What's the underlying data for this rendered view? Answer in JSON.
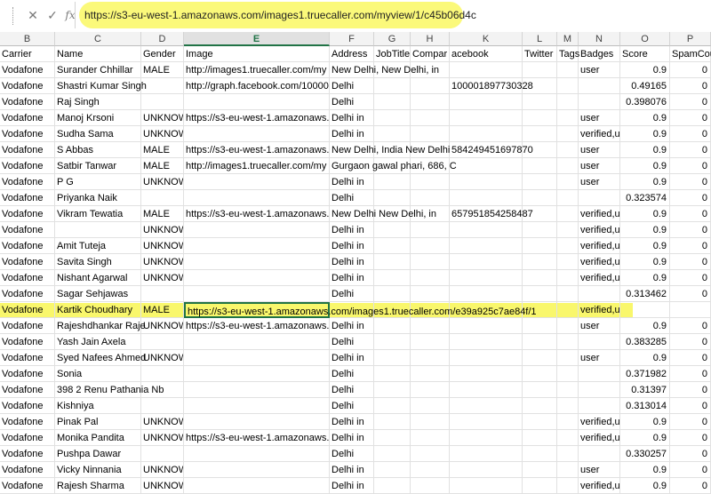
{
  "formula_bar": {
    "cancel_icon": "cross-icon",
    "enter_icon": "check-icon",
    "function_label": "fx",
    "content": "https://s3-eu-west-1.amazonaws.com/images1.truecaller.com/myview/1/c45b06d4c"
  },
  "columns": [
    "B",
    "C",
    "D",
    "E",
    "F",
    "G",
    "H",
    "K",
    "L",
    "M",
    "N",
    "O",
    "P"
  ],
  "active_column": "E",
  "highlight_color": "#fbf97a",
  "header_row": [
    "Carrier",
    "Name",
    "Gender",
    "Image",
    "Address",
    "JobTitle",
    "Compar",
    "acebook",
    "Twitter",
    "Tags",
    "Badges",
    "Score",
    "SpamCount"
  ],
  "rows": [
    [
      "Vodafone",
      "Surander Chhillar",
      "MALE",
      "http://images1.truecaller.com/my",
      "New Delhi, New Delhi, in",
      "",
      "",
      "",
      "",
      "",
      "user",
      "0.9",
      "0"
    ],
    [
      "Vodafone",
      "Shastri Kumar Singh",
      "",
      "http://graph.facebook.com/10000",
      "Delhi",
      "",
      "",
      "100001897730328",
      "",
      "",
      "",
      "0.49165",
      "0"
    ],
    [
      "Vodafone",
      "Raj Singh",
      "",
      "",
      "Delhi",
      "",
      "",
      "",
      "",
      "",
      "",
      "0.398076",
      "0"
    ],
    [
      "Vodafone",
      "Manoj Krsoni",
      "UNKNOWN",
      "https://s3-eu-west-1.amazonaws.",
      "Delhi in",
      "",
      "",
      "",
      "",
      "",
      "user",
      "0.9",
      "0"
    ],
    [
      "Vodafone",
      "Sudha Sama",
      "UNKNOWN",
      "",
      "Delhi in",
      "",
      "",
      "",
      "",
      "",
      "verified,u",
      "0.9",
      "0"
    ],
    [
      "Vodafone",
      "S Abbas",
      "MALE",
      "https://s3-eu-west-1.amazonaws.",
      "New Delhi, India New Delhi",
      "",
      "",
      "584249451697870",
      "",
      "",
      "user",
      "0.9",
      "0"
    ],
    [
      "Vodafone",
      "Satbir Tanwar",
      "MALE",
      "http://images1.truecaller.com/my",
      "Gurgaon gawal phari, 686, C",
      "",
      "",
      "",
      "",
      "",
      "user",
      "0.9",
      "0"
    ],
    [
      "Vodafone",
      "P G",
      "UNKNOWN",
      "",
      "Delhi in",
      "",
      "",
      "",
      "",
      "",
      "user",
      "0.9",
      "0"
    ],
    [
      "Vodafone",
      "Priyanka Naik",
      "",
      "",
      "Delhi",
      "",
      "",
      "",
      "",
      "",
      "",
      "0.323574",
      "0"
    ],
    [
      "Vodafone",
      "Vikram Tewatia",
      "MALE",
      "https://s3-eu-west-1.amazonaws.",
      "New Delhi New Delhi, in",
      "",
      "",
      "657951854258487",
      "",
      "",
      "verified,u",
      "0.9",
      "0"
    ],
    [
      "Vodafone",
      "",
      "UNKNOWN",
      "",
      "Delhi in",
      "",
      "",
      "",
      "",
      "",
      "verified,u",
      "0.9",
      "0"
    ],
    [
      "Vodafone",
      "Amit Tuteja",
      "UNKNOWN",
      "",
      "Delhi in",
      "",
      "",
      "",
      "",
      "",
      "verified,u",
      "0.9",
      "0"
    ],
    [
      "Vodafone",
      "Savita Singh",
      "UNKNOWN",
      "",
      "Delhi in",
      "",
      "",
      "",
      "",
      "",
      "verified,u",
      "0.9",
      "0"
    ],
    [
      "Vodafone",
      "Nishant Agarwal",
      "UNKNOWN",
      "",
      "Delhi in",
      "",
      "",
      "",
      "",
      "",
      "verified,u",
      "0.9",
      "0"
    ],
    [
      "Vodafone",
      "Sagar Sehjawas",
      "",
      "",
      "Delhi",
      "",
      "",
      "",
      "",
      "",
      "",
      "0.313462",
      "0"
    ],
    [
      "Vodafone",
      "Kartik Choudhary",
      "MALE",
      "https://s3-eu-west-1.amazonaws.com/images1.truecaller.com/e39a925c7ae84f/1",
      "",
      "",
      "",
      "",
      "",
      "",
      "verified,u",
      "",
      ""
    ],
    [
      "Vodafone",
      "Rajeshdhankar Raje",
      "UNKNOW",
      "https://s3-eu-west-1.amazonaws.",
      "Delhi in",
      "",
      "",
      "",
      "",
      "",
      "user",
      "0.9",
      "0"
    ],
    [
      "Vodafone",
      "Yash Jain Axela",
      "",
      "",
      "Delhi",
      "",
      "",
      "",
      "",
      "",
      "",
      "0.383285",
      "0"
    ],
    [
      "Vodafone",
      "Syed Nafees Ahmed",
      "UNKNOWN",
      "",
      "Delhi in",
      "",
      "",
      "",
      "",
      "",
      "user",
      "0.9",
      "0"
    ],
    [
      "Vodafone",
      "Sonia",
      "",
      "",
      "Delhi",
      "",
      "",
      "",
      "",
      "",
      "",
      "0.371982",
      "0"
    ],
    [
      "Vodafone",
      "398 2 Renu Pathania Nb",
      "",
      "",
      "Delhi",
      "",
      "",
      "",
      "",
      "",
      "",
      "0.31397",
      "0"
    ],
    [
      "Vodafone",
      "Kishniya",
      "",
      "",
      "Delhi",
      "",
      "",
      "",
      "",
      "",
      "",
      "0.313014",
      "0"
    ],
    [
      "Vodafone",
      "Pinak Pal",
      "UNKNOWN",
      "",
      "Delhi in",
      "",
      "",
      "",
      "",
      "",
      "verified,u",
      "0.9",
      "0"
    ],
    [
      "Vodafone",
      "Monika Pandita",
      "UNKNOWN",
      "https://s3-eu-west-1.amazonaws.",
      "Delhi in",
      "",
      "",
      "",
      "",
      "",
      "verified,u",
      "0.9",
      "0"
    ],
    [
      "Vodafone",
      "Pushpa Dawar",
      "",
      "",
      "Delhi",
      "",
      "",
      "",
      "",
      "",
      "",
      "0.330257",
      "0"
    ],
    [
      "Vodafone",
      "Vicky Ninnania",
      "UNKNOWN",
      "",
      "Delhi in",
      "",
      "",
      "",
      "",
      "",
      "user",
      "0.9",
      "0"
    ],
    [
      "Vodafone",
      "Rajesh Sharma",
      "UNKNOWN",
      "",
      "Delhi in",
      "",
      "",
      "",
      "",
      "",
      "verified,u",
      "0.9",
      "0"
    ]
  ]
}
